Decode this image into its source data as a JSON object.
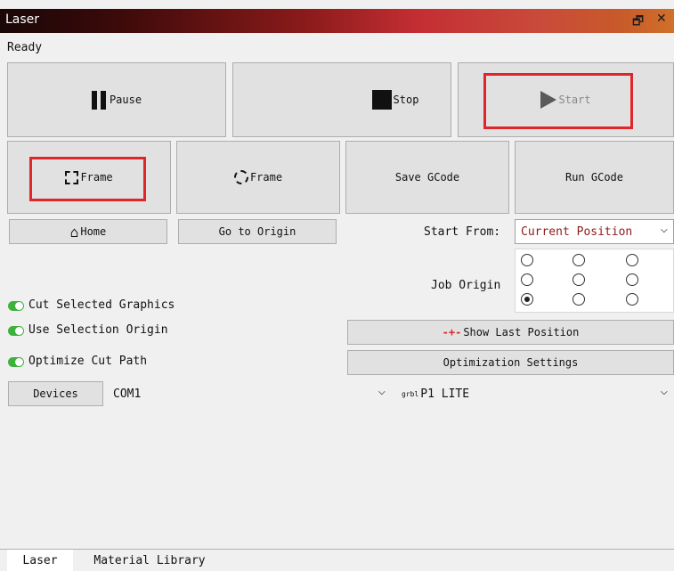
{
  "window": {
    "title": "Laser"
  },
  "status": "Ready",
  "buttons": {
    "pause": "Pause",
    "stop": "Stop",
    "start": "Start",
    "frame_rect": "Frame",
    "frame_circle": "Frame",
    "save_gcode": "Save GCode",
    "run_gcode": "Run GCode",
    "home": "Home",
    "go_to_origin": "Go to Origin",
    "show_last_position": "Show Last Position",
    "optimization_settings": "Optimization Settings",
    "devices": "Devices"
  },
  "start_from": {
    "label": "Start From:",
    "value": "Current Position"
  },
  "job_origin": {
    "label": "Job Origin",
    "selected_index": 6
  },
  "toggles": [
    {
      "label": "Cut Selected Graphics"
    },
    {
      "label": "Use Selection Origin"
    },
    {
      "label": "Optimize Cut Path"
    }
  ],
  "port": {
    "value": "COM1"
  },
  "device": {
    "badge": "grbl",
    "value": "P1 LITE"
  },
  "tabs": [
    {
      "label": "Laser"
    },
    {
      "label": "Material Library"
    }
  ],
  "colors": {
    "highlight": "#e0262a",
    "toggle_on": "#3db23d"
  }
}
